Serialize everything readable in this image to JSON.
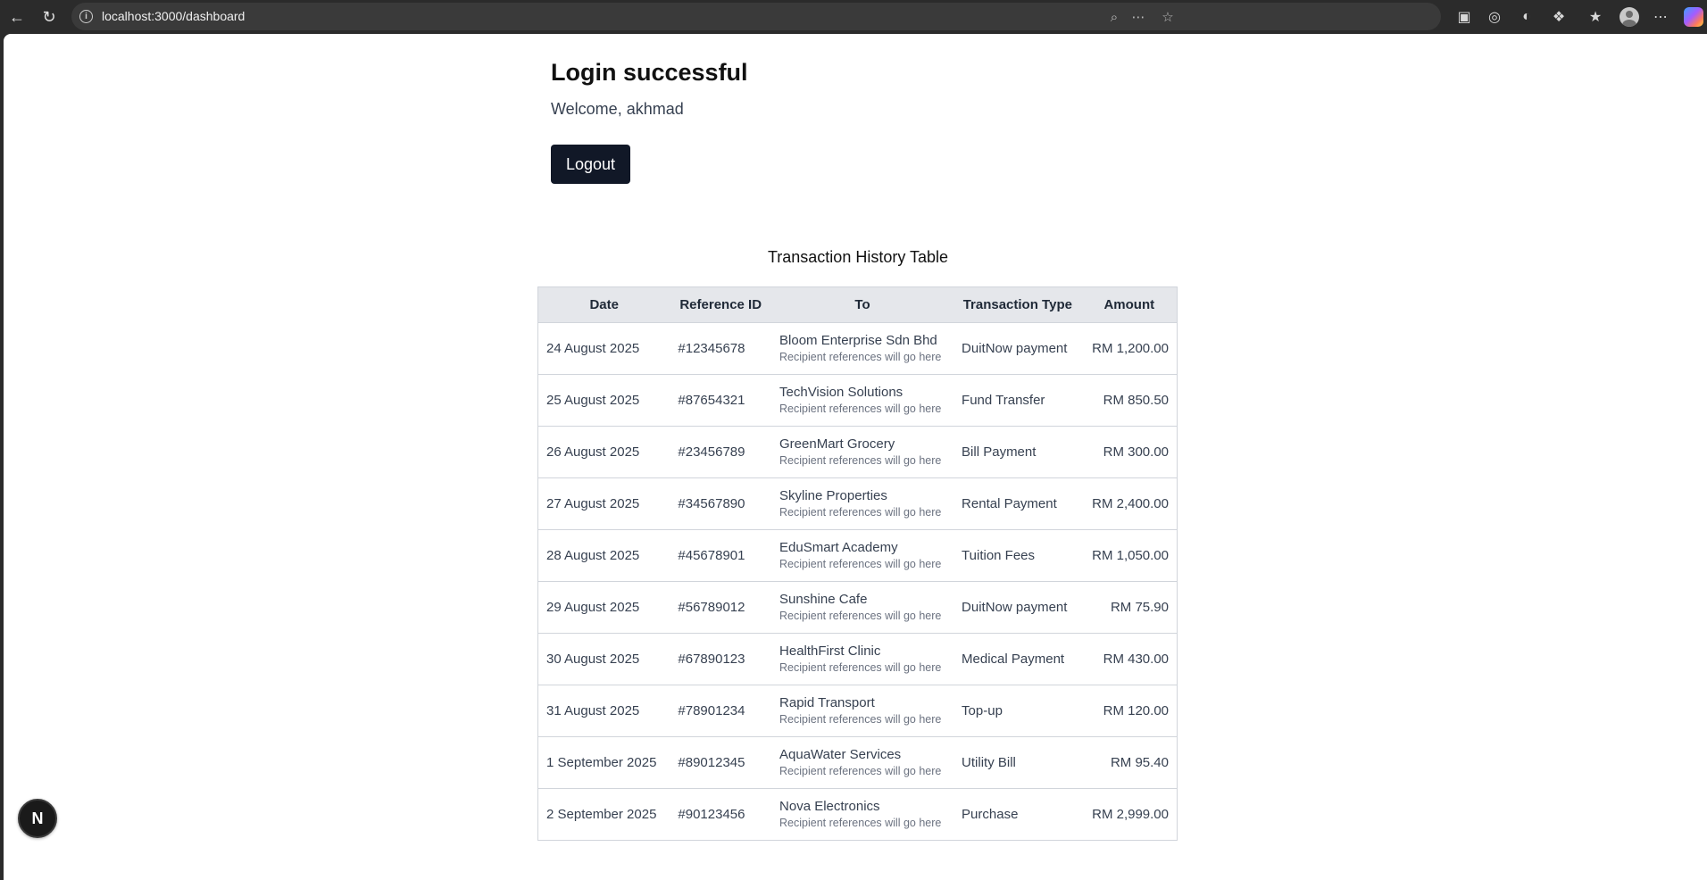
{
  "browser": {
    "url": "localhost:3000/dashboard",
    "icons": [
      "back-icon",
      "reload-icon",
      "site-info-icon",
      "zoom-icon",
      "reader-icon",
      "favorite-star-icon",
      "extension-icon",
      "extension-icon",
      "extension-icon",
      "extensions-puzzle-icon",
      "favorites-icon",
      "profile-avatar",
      "more-menu-icon",
      "copilot-icon"
    ]
  },
  "page": {
    "heading": "Login successful",
    "welcome": "Welcome, akhmad",
    "logout_label": "Logout",
    "table_caption": "Transaction History Table",
    "columns": [
      "Date",
      "Reference ID",
      "To",
      "Transaction Type",
      "Amount"
    ],
    "rows": [
      {
        "date": "24 August 2025",
        "ref": "#12345678",
        "to": "Bloom Enterprise Sdn Bhd",
        "to_ref": "Recipient references will go here",
        "type": "DuitNow payment",
        "amount": "RM 1,200.00"
      },
      {
        "date": "25 August 2025",
        "ref": "#87654321",
        "to": "TechVision Solutions",
        "to_ref": "Recipient references will go here",
        "type": "Fund Transfer",
        "amount": "RM 850.50"
      },
      {
        "date": "26 August 2025",
        "ref": "#23456789",
        "to": "GreenMart Grocery",
        "to_ref": "Recipient references will go here",
        "type": "Bill Payment",
        "amount": "RM 300.00"
      },
      {
        "date": "27 August 2025",
        "ref": "#34567890",
        "to": "Skyline Properties",
        "to_ref": "Recipient references will go here",
        "type": "Rental Payment",
        "amount": "RM 2,400.00"
      },
      {
        "date": "28 August 2025",
        "ref": "#45678901",
        "to": "EduSmart Academy",
        "to_ref": "Recipient references will go here",
        "type": "Tuition Fees",
        "amount": "RM 1,050.00"
      },
      {
        "date": "29 August 2025",
        "ref": "#56789012",
        "to": "Sunshine Cafe",
        "to_ref": "Recipient references will go here",
        "type": "DuitNow payment",
        "amount": "RM 75.90"
      },
      {
        "date": "30 August 2025",
        "ref": "#67890123",
        "to": "HealthFirst Clinic",
        "to_ref": "Recipient references will go here",
        "type": "Medical Payment",
        "amount": "RM 430.00"
      },
      {
        "date": "31 August 2025",
        "ref": "#78901234",
        "to": "Rapid Transport",
        "to_ref": "Recipient references will go here",
        "type": "Top-up",
        "amount": "RM 120.00"
      },
      {
        "date": "1 September 2025",
        "ref": "#89012345",
        "to": "AquaWater Services",
        "to_ref": "Recipient references will go here",
        "type": "Utility Bill",
        "amount": "RM 95.40"
      },
      {
        "date": "2 September 2025",
        "ref": "#90123456",
        "to": "Nova Electronics",
        "to_ref": "Recipient references will go here",
        "type": "Purchase",
        "amount": "RM 2,999.00"
      }
    ]
  },
  "dev_badge": {
    "letter": "N"
  },
  "colors": {
    "button_bg": "#111827",
    "header_bg": "#e5e7eb",
    "chrome_bg": "#2b2b2b"
  }
}
